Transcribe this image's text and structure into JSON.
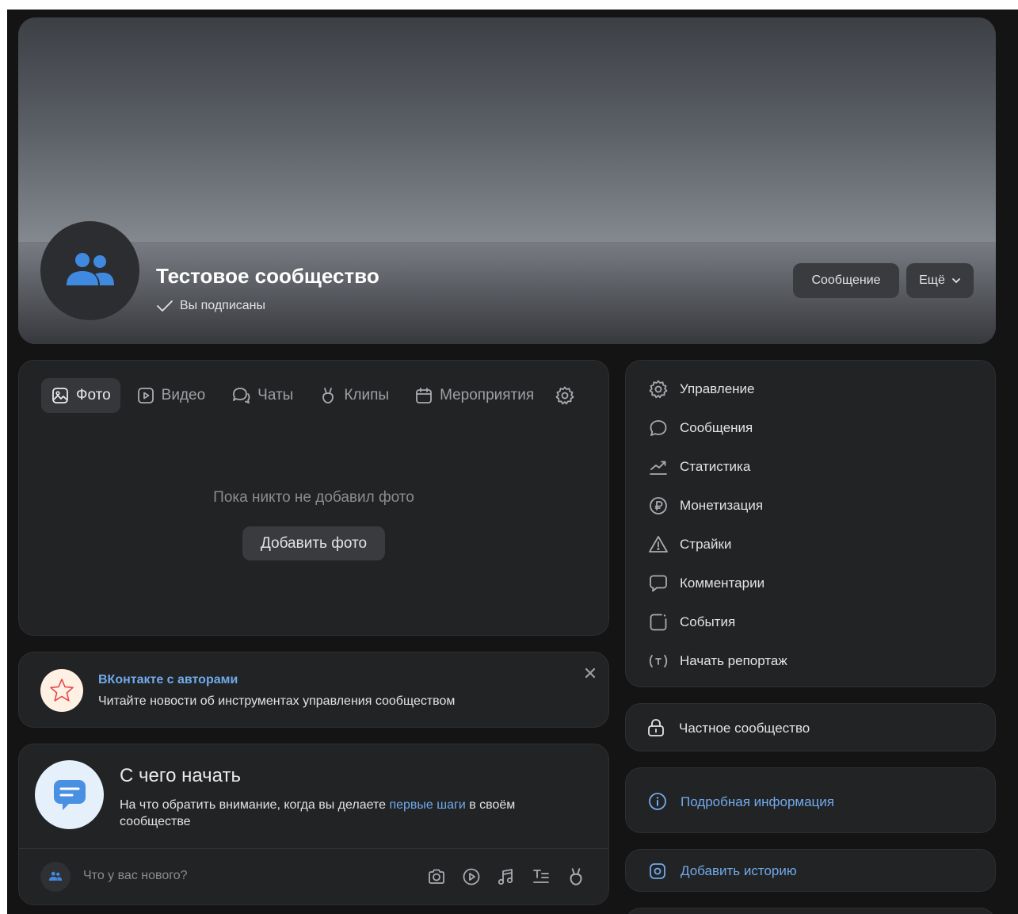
{
  "group": {
    "name": "Тестовое сообщество",
    "subscribed_label": "Вы подписаны"
  },
  "header_actions": {
    "message_label": "Сообщение",
    "more_label": "Ещё"
  },
  "tabs": [
    {
      "label": "Фото",
      "icon": "photo-icon",
      "active": true
    },
    {
      "label": "Видео",
      "icon": "video-icon",
      "active": false
    },
    {
      "label": "Чаты",
      "icon": "chats-icon",
      "active": false
    },
    {
      "label": "Клипы",
      "icon": "clips-icon",
      "active": false
    },
    {
      "label": "Мероприятия",
      "icon": "calendar-icon",
      "active": false
    }
  ],
  "media": {
    "empty_text": "Пока никто не добавил фото",
    "add_photo_label": "Добавить фото"
  },
  "promo": {
    "title": "ВКонтакте с авторами",
    "text": "Читайте новости об инструментах управления сообществом"
  },
  "getting_started": {
    "title": "С чего начать",
    "text_before": "На что обратить внимание, когда вы делаете ",
    "link": "первые шаги",
    "text_after": " в своём сообществе"
  },
  "composer": {
    "placeholder": "Что у вас нового?"
  },
  "admin_menu": [
    {
      "label": "Управление",
      "icon": "gear-icon"
    },
    {
      "label": "Сообщения",
      "icon": "message-icon"
    },
    {
      "label": "Статистика",
      "icon": "stats-icon"
    },
    {
      "label": "Монетизация",
      "icon": "ruble-icon"
    },
    {
      "label": "Страйки",
      "icon": "warning-icon"
    },
    {
      "label": "Комментарии",
      "icon": "comment-icon"
    },
    {
      "label": "События",
      "icon": "events-icon"
    },
    {
      "label": "Начать репортаж",
      "icon": "broadcast-icon"
    }
  ],
  "private": {
    "label": "Частное сообщество"
  },
  "info": {
    "label": "Подробная информация"
  },
  "story": {
    "label": "Добавить историю"
  },
  "colors": {
    "background": "#141414",
    "card": "#222325",
    "accent": "#71aaeb",
    "avatar_icon": "#3f8ae0",
    "button": "#3a3b3e"
  }
}
